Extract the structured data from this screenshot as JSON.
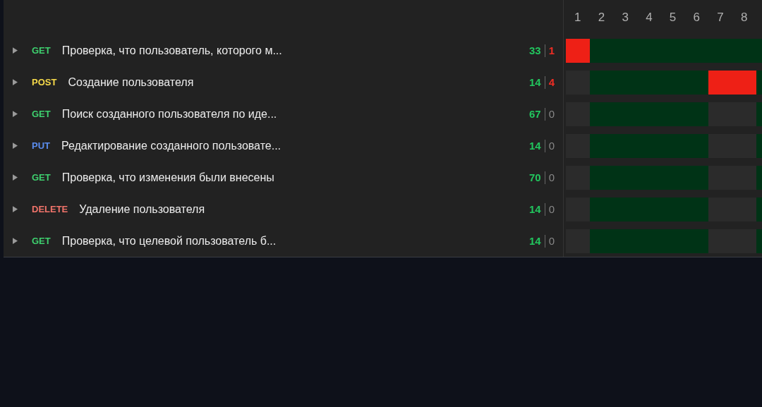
{
  "columns": [
    "1",
    "2",
    "3",
    "4",
    "5",
    "6",
    "7",
    "8"
  ],
  "rows": [
    {
      "method": {
        "label": "GET",
        "color": "#3ecf6e"
      },
      "title": "Проверка, что пользователь, которого м...",
      "passed": "33",
      "failed": "1",
      "failing": true,
      "cells": [
        {
          "kind": "fail"
        },
        {
          "kind": "pass"
        },
        {
          "kind": "pass"
        },
        {
          "kind": "pass"
        },
        {
          "kind": "pass"
        },
        {
          "kind": "pass"
        },
        {
          "kind": "pass"
        },
        {
          "kind": "pass"
        },
        {
          "kind": "pass"
        }
      ]
    },
    {
      "method": {
        "label": "POST",
        "color": "#f5d94a"
      },
      "title": "Создание пользователя",
      "passed": "14",
      "failed": "4",
      "failing": true,
      "cells": [
        {
          "kind": "none"
        },
        {
          "kind": "pass"
        },
        {
          "kind": "pass"
        },
        {
          "kind": "pass"
        },
        {
          "kind": "pass"
        },
        {
          "kind": "pass"
        },
        {
          "kind": "fail"
        },
        {
          "kind": "fail"
        },
        {
          "kind": "pass"
        }
      ]
    },
    {
      "method": {
        "label": "GET",
        "color": "#3ecf6e"
      },
      "title": "Поиск созданного пользователя по иде...",
      "passed": "67",
      "failed": "0",
      "failing": false,
      "cells": [
        {
          "kind": "none"
        },
        {
          "kind": "pass"
        },
        {
          "kind": "pass"
        },
        {
          "kind": "pass"
        },
        {
          "kind": "pass"
        },
        {
          "kind": "pass"
        },
        {
          "kind": "none"
        },
        {
          "kind": "none"
        },
        {
          "kind": "pass"
        }
      ]
    },
    {
      "method": {
        "label": "PUT",
        "color": "#5b8def"
      },
      "title": "Редактирование созданного пользовате...",
      "passed": "14",
      "failed": "0",
      "failing": false,
      "cells": [
        {
          "kind": "none"
        },
        {
          "kind": "pass"
        },
        {
          "kind": "pass"
        },
        {
          "kind": "pass"
        },
        {
          "kind": "pass"
        },
        {
          "kind": "pass"
        },
        {
          "kind": "none"
        },
        {
          "kind": "none"
        },
        {
          "kind": "pass"
        }
      ]
    },
    {
      "method": {
        "label": "GET",
        "color": "#3ecf6e"
      },
      "title": "Проверка, что изменения были внесены",
      "passed": "70",
      "failed": "0",
      "failing": false,
      "cells": [
        {
          "kind": "none"
        },
        {
          "kind": "pass"
        },
        {
          "kind": "pass"
        },
        {
          "kind": "pass"
        },
        {
          "kind": "pass"
        },
        {
          "kind": "pass"
        },
        {
          "kind": "none"
        },
        {
          "kind": "none"
        },
        {
          "kind": "pass"
        }
      ]
    },
    {
      "method": {
        "label": "DELETE",
        "color": "#f0736a"
      },
      "title": "Удаление пользователя",
      "passed": "14",
      "failed": "0",
      "failing": false,
      "cells": [
        {
          "kind": "none"
        },
        {
          "kind": "pass"
        },
        {
          "kind": "pass"
        },
        {
          "kind": "pass"
        },
        {
          "kind": "pass"
        },
        {
          "kind": "pass"
        },
        {
          "kind": "none"
        },
        {
          "kind": "none"
        },
        {
          "kind": "pass"
        }
      ]
    },
    {
      "method": {
        "label": "GET",
        "color": "#3ecf6e"
      },
      "title": "Проверка, что целевой пользователь б...",
      "passed": "14",
      "failed": "0",
      "failing": false,
      "cells": [
        {
          "kind": "none"
        },
        {
          "kind": "pass"
        },
        {
          "kind": "pass"
        },
        {
          "kind": "pass"
        },
        {
          "kind": "pass"
        },
        {
          "kind": "pass"
        },
        {
          "kind": "none"
        },
        {
          "kind": "none"
        },
        {
          "kind": "pass"
        }
      ]
    }
  ]
}
